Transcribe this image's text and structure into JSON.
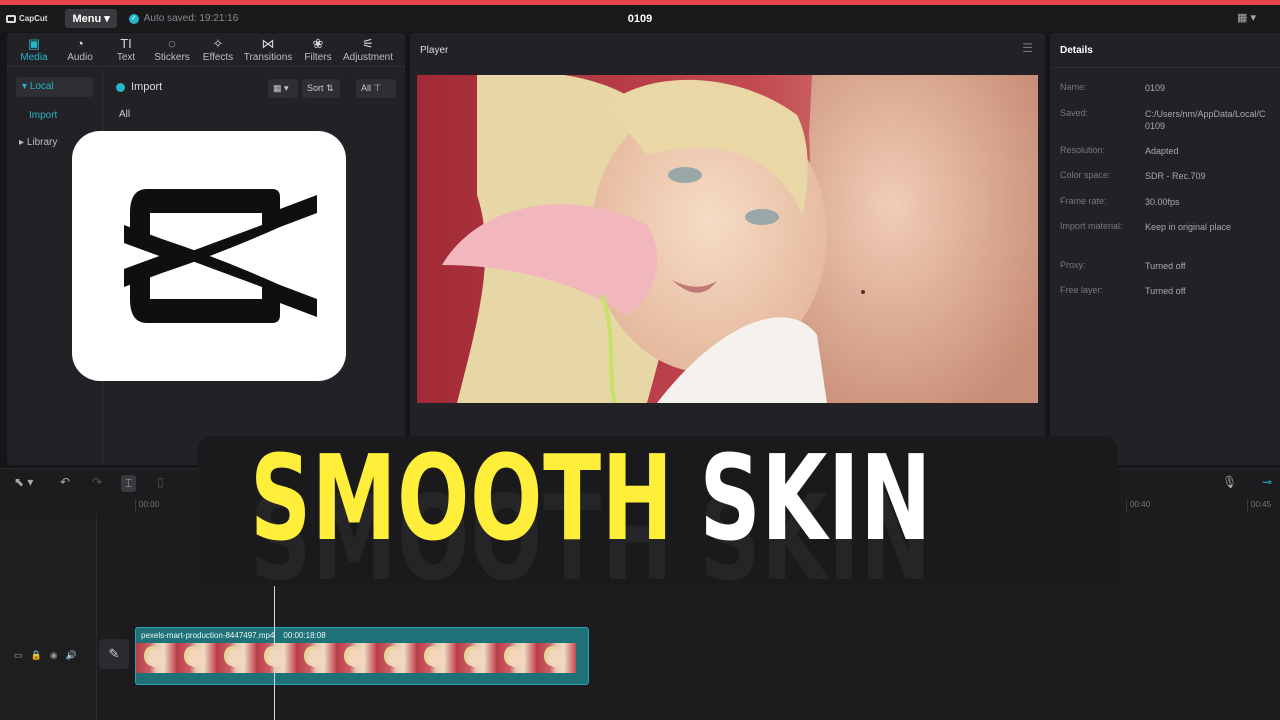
{
  "app": {
    "brand": "CapCut",
    "menu_label": "Menu",
    "autosave": "Auto saved: 19:21:16",
    "project_title": "0109"
  },
  "media_toolbar": {
    "items": [
      {
        "label": "Media",
        "icon": "media-icon"
      },
      {
        "label": "Audio",
        "icon": "audio-icon"
      },
      {
        "label": "Text",
        "icon": "text-icon"
      },
      {
        "label": "Stickers",
        "icon": "stickers-icon"
      },
      {
        "label": "Effects",
        "icon": "effects-icon"
      },
      {
        "label": "Transitions",
        "icon": "transitions-icon"
      },
      {
        "label": "Filters",
        "icon": "filters-icon"
      },
      {
        "label": "Adjustment",
        "icon": "adjustment-icon"
      }
    ]
  },
  "media_side": {
    "local": "Local",
    "import": "Import",
    "library": "Library"
  },
  "media_head": {
    "import": "Import",
    "sort": "Sort",
    "all_filter": "All",
    "all_label": "All"
  },
  "player": {
    "title": "Player"
  },
  "details": {
    "title": "Details",
    "rows": [
      {
        "key": "Name:",
        "value": "0109"
      },
      {
        "key": "Saved:",
        "value": "C:/Users/nm/AppData/Local/C 0109"
      },
      {
        "key": "Resolution:",
        "value": "Adapted"
      },
      {
        "key": "Color space:",
        "value": "SDR - Rec.709"
      },
      {
        "key": "Frame rate:",
        "value": "30.00fps"
      },
      {
        "key": "Import material:",
        "value": "Keep in original place"
      },
      {
        "key": "Proxy:",
        "value": "Turned off"
      },
      {
        "key": "Free layer:",
        "value": "Turned off"
      }
    ]
  },
  "timeline": {
    "ticks": [
      "00:00",
      "00:40",
      "00:45"
    ],
    "clip_name": "pexels-mart-production-8447497.mp4",
    "clip_duration": "00:00:18:08",
    "thumbnail_count": 11
  },
  "overlay": {
    "headline_word1": "SMOOTH",
    "headline_word2": "SKIN"
  },
  "colors": {
    "accent": "#25b6c7",
    "headline_yellow": "#ffee3a",
    "top_bar": "#e8454a"
  }
}
